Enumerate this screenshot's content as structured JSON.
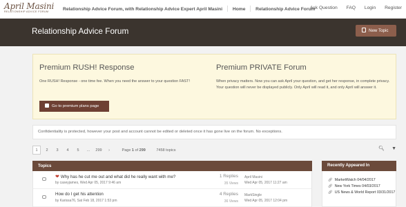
{
  "header": {
    "logo_script": "April Masini",
    "logo_tag": "RELATIONSHIP ADVICE FORUM",
    "breadcrumb": [
      "Relationship Advice Forum, with Relationship Advice Expert April Masini",
      "Home",
      "Relationship Advice Forum"
    ],
    "nav": [
      "Ask Question",
      "FAQ",
      "Login",
      "Register"
    ]
  },
  "hero": {
    "title": "Relationship Advice Forum",
    "new_topic": "New Topic"
  },
  "premium": {
    "rush_title": "Premium RUSH! Response",
    "rush_text": "One RUSH! Response - one time fee. When you need the answer to your question FAST!",
    "private_title": "Premium PRIVATE Forum",
    "private_text": "When privacy matters. Now you can ask April your question, and get her response, in complete privacy. Your question will never be displayed publicly. Only April will read it, and only April will answer it.",
    "button": "Go to premium plans page"
  },
  "notice": "Confidentiality is protected, however your post and account cannot be edited or deleted once it has gone live on the forum. No exceptions.",
  "pagination": {
    "pages": [
      "1",
      "2",
      "3",
      "4",
      "5",
      "…",
      "299",
      "›"
    ],
    "page_prefix": "Page",
    "page_current": "1",
    "page_of": "of",
    "page_total": "299",
    "topics_count": "7458 topics"
  },
  "topics": {
    "header": "Topics",
    "rows": [
      {
        "title": "Why has he cut me out and what did he really want with me?",
        "by": "by caseyjames, Wed Apr 05, 2017 9:46 am",
        "replies": "1 Replies",
        "views": "35 Views",
        "last_user": "April Masini",
        "last_date": "Wed Apr 05, 2017 11:27 am"
      },
      {
        "title": "How do I get his attention",
        "by": "by Karissa76, Sat Feb 18, 2017 1:53 pm",
        "replies": "4 Replies",
        "views": "36 Views",
        "last_user": "MarkSingle",
        "last_date": "Wed Apr 05, 2017 12:04 pm"
      }
    ]
  },
  "recent": {
    "header": "Recently Appeared In",
    "items": [
      "MarketWatch 04/04/2017",
      "New York Times 04/03/2017",
      "US News & World Report 03/31/2017"
    ]
  },
  "colors": {
    "hero_bg": "#3b342e",
    "accent": "#8c5e4c",
    "premium_bg": "#fdf8df",
    "panel_header": "#6b4a3b"
  }
}
